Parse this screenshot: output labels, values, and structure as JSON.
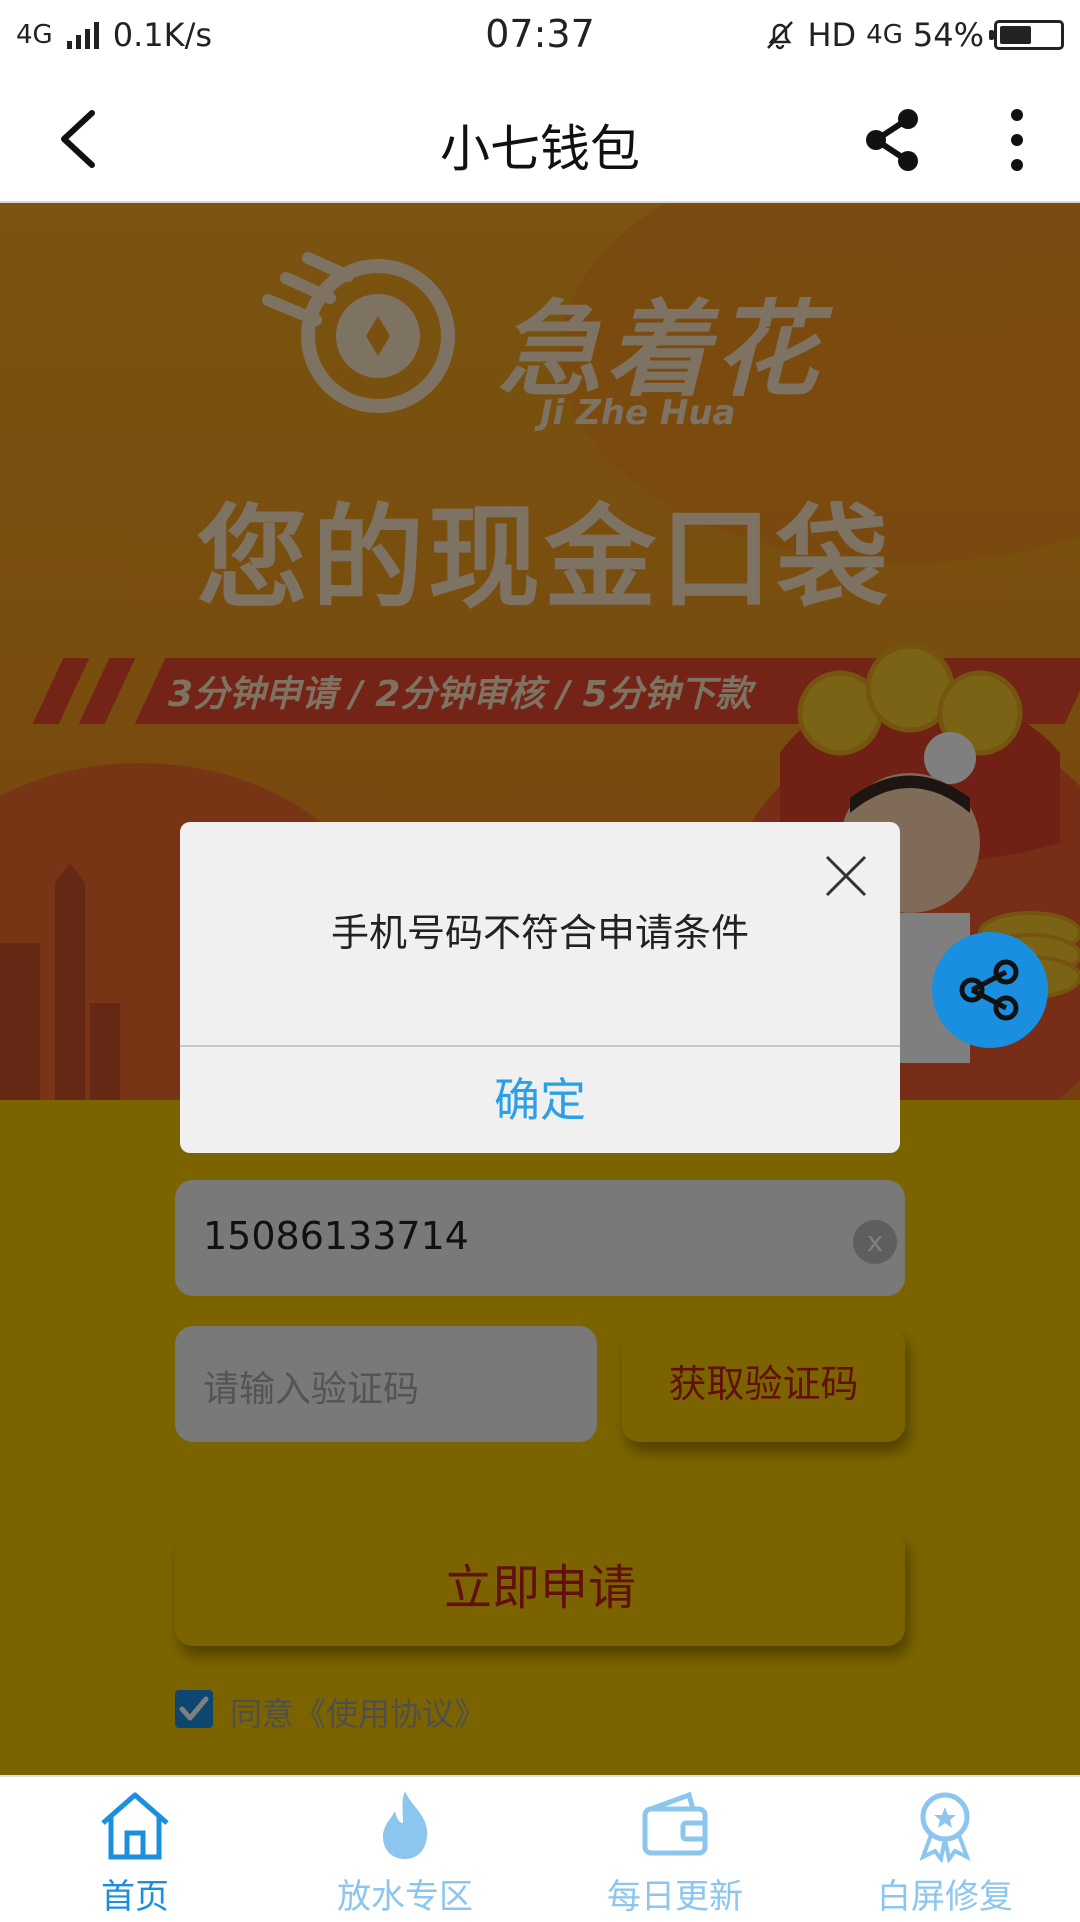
{
  "status_bar": {
    "network": "4G",
    "speed": "0.1K/s",
    "time": "07:37",
    "hd": "HD",
    "net2": "4G",
    "battery": "54%",
    "battery_level": 0.54
  },
  "title_bar": {
    "title": "小七钱包",
    "back_icon": "back-arrow",
    "share_icon": "share",
    "more_icon": "more-vertical"
  },
  "banner": {
    "brand_name": "急着花",
    "brand_pinyin": "Ji Zhe Hua",
    "slogan": "您的现金口袋",
    "ribbon_text": "3分钟申请 / 2分钟审核 / 5分钟下款"
  },
  "form": {
    "phone_value": "15086133714",
    "clear_label": "x",
    "code_placeholder": "请输入验证码",
    "get_code_label": "获取验证码",
    "apply_label": "立即申请",
    "agree_label": "同意《使用协议》",
    "agree_checked": true
  },
  "dialog": {
    "message": "手机号码不符合申请条件",
    "confirm_label": "确定"
  },
  "bottom_nav": [
    {
      "label": "首页",
      "icon": "home",
      "active": true
    },
    {
      "label": "放水专区",
      "icon": "fire",
      "active": false
    },
    {
      "label": "每日更新",
      "icon": "wallet",
      "active": false
    },
    {
      "label": "白屏修复",
      "icon": "badge",
      "active": false
    }
  ],
  "colors": {
    "accent": "#1a8fe0",
    "dialog_confirm": "#2aa0e6",
    "button_yellow": "#f7c800",
    "button_text_red": "#c21f1f"
  }
}
